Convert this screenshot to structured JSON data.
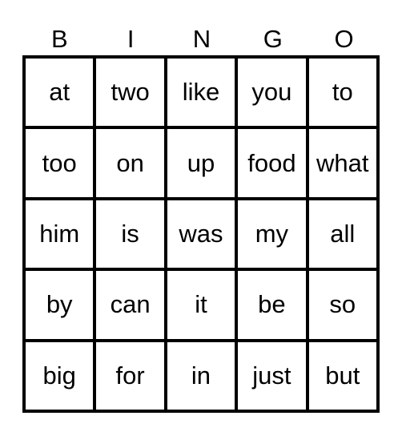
{
  "header": [
    "B",
    "I",
    "N",
    "G",
    "O"
  ],
  "rows": [
    [
      "at",
      "two",
      "like",
      "you",
      "to"
    ],
    [
      "too",
      "on",
      "up",
      "food",
      "what"
    ],
    [
      "him",
      "is",
      "was",
      "my",
      "all"
    ],
    [
      "by",
      "can",
      "it",
      "be",
      "so"
    ],
    [
      "big",
      "for",
      "in",
      "just",
      "but"
    ]
  ]
}
